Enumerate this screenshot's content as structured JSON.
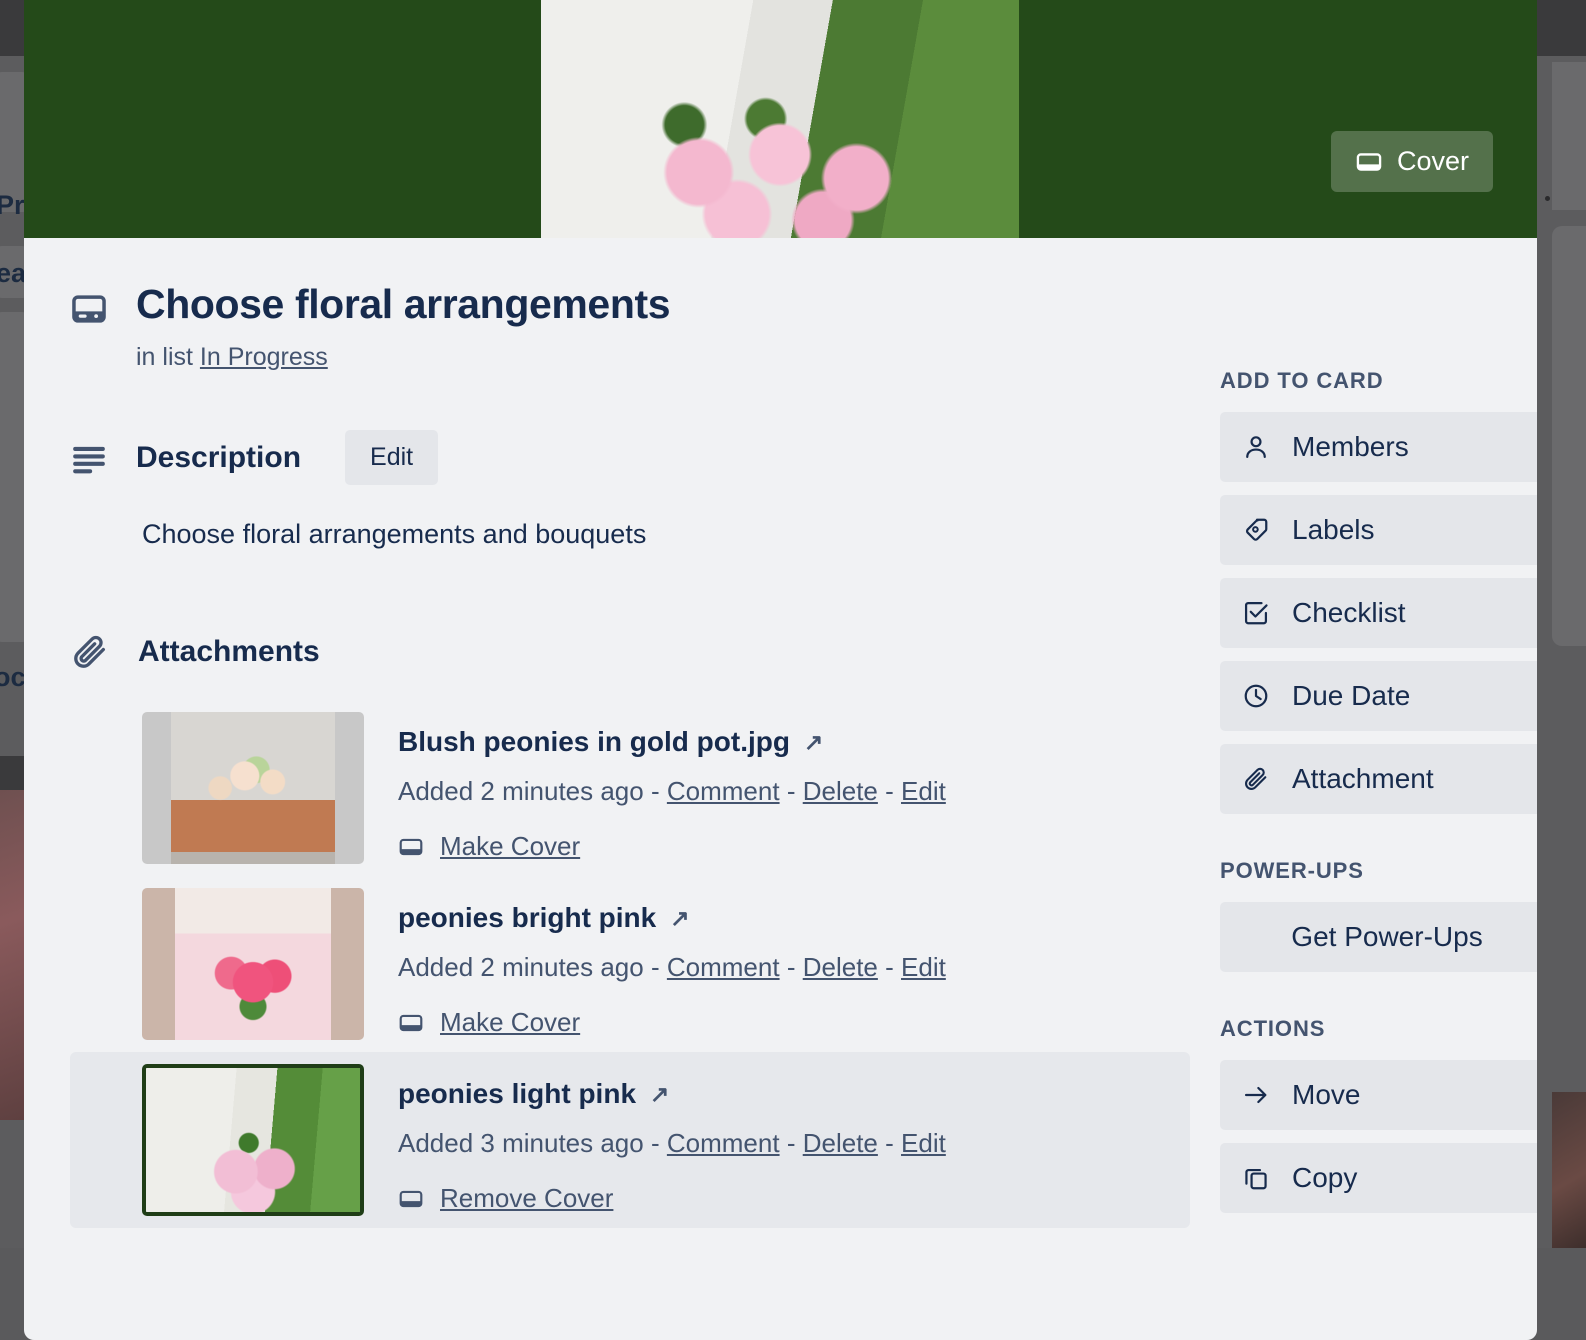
{
  "background": {
    "fragment_texts": [
      "Pro",
      "eat",
      "oc"
    ]
  },
  "cover": {
    "button_label": "Cover",
    "button_icon": "cover-icon",
    "close_icon": "close-icon",
    "color": "#244a19"
  },
  "card": {
    "icon": "card-icon",
    "title": "Choose floral arrangements",
    "in_list_prefix": "in list",
    "list_name": "In Progress"
  },
  "description": {
    "icon": "description-icon",
    "title": "Description",
    "edit_label": "Edit",
    "text": "Choose floral arrangements and bouquets"
  },
  "attachments": {
    "icon": "paperclip-icon",
    "title": "Attachments",
    "items": [
      {
        "name": "Blush peonies in gold pot.jpg",
        "open_icon": "external-link-icon",
        "added": "Added 2 minutes ago",
        "separator": "-",
        "comment_label": "Comment",
        "delete_label": "Delete",
        "edit_label": "Edit",
        "cover_action": "Make Cover",
        "cover_icon": "cover-icon",
        "is_cover": false
      },
      {
        "name": "peonies bright pink",
        "open_icon": "external-link-icon",
        "added": "Added 2 minutes ago",
        "separator": "-",
        "comment_label": "Comment",
        "delete_label": "Delete",
        "edit_label": "Edit",
        "cover_action": "Make Cover",
        "cover_icon": "cover-icon",
        "is_cover": false
      },
      {
        "name": "peonies light pink",
        "open_icon": "external-link-icon",
        "added": "Added 3 minutes ago",
        "separator": "-",
        "comment_label": "Comment",
        "delete_label": "Delete",
        "edit_label": "Edit",
        "cover_action": "Remove Cover",
        "cover_icon": "cover-icon",
        "is_cover": true
      }
    ]
  },
  "sidebar": {
    "add_to_card": {
      "title": "ADD TO CARD",
      "items": [
        {
          "label": "Members",
          "icon": "person-icon"
        },
        {
          "label": "Labels",
          "icon": "tag-icon"
        },
        {
          "label": "Checklist",
          "icon": "checkbox-icon"
        },
        {
          "label": "Due Date",
          "icon": "clock-icon"
        },
        {
          "label": "Attachment",
          "icon": "paperclip-icon"
        }
      ]
    },
    "power_ups": {
      "title": "POWER-UPS",
      "items": [
        {
          "label": "Get Power-Ups",
          "icon": "none"
        }
      ]
    },
    "actions": {
      "title": "ACTIONS",
      "items": [
        {
          "label": "Move",
          "icon": "arrow-right-icon"
        },
        {
          "label": "Copy",
          "icon": "copy-icon"
        }
      ]
    }
  },
  "colors": {
    "cover_green": "#244a19",
    "modal_bg": "#f1f2f4",
    "button_bg": "#e4e6ea",
    "text_primary": "#172b4d",
    "text_secondary": "#44546f",
    "active_row_bg": "#e6e8ec",
    "active_cover_border": "#1f3d17"
  }
}
